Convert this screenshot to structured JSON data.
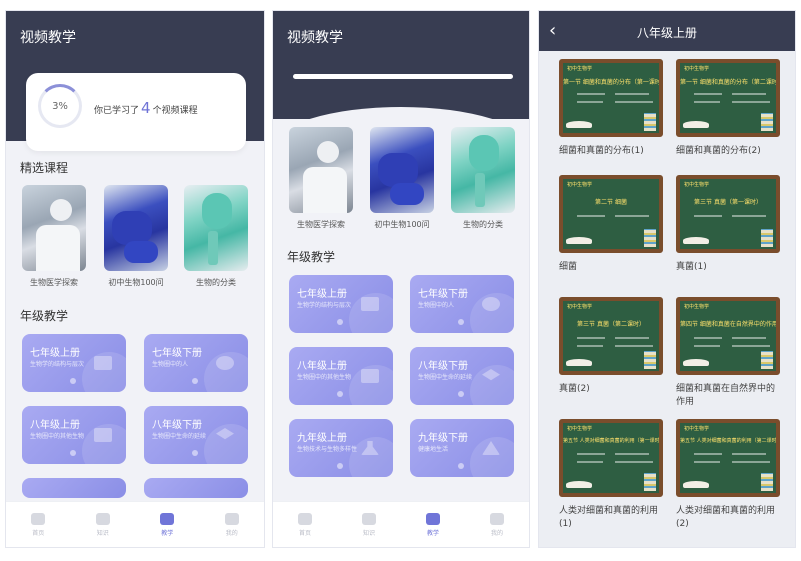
{
  "screen1": {
    "header_title": "视频教学",
    "progress": {
      "percent_label": "3%",
      "percent_value": 3,
      "text_before": "你已学习了",
      "count": "4",
      "text_after": "个视频课程"
    },
    "featured_title": "精选课程",
    "courses": [
      {
        "caption": "生物医学探索"
      },
      {
        "caption": "初中生物100问"
      },
      {
        "caption": "生物的分类"
      }
    ],
    "grade_title": "年级教学",
    "grades": [
      {
        "name": "七年级上册",
        "sub": "生物学的结构与层次"
      },
      {
        "name": "七年级下册",
        "sub": "生物圈中的人"
      },
      {
        "name": "八年级上册",
        "sub": "生物圈中的其他生物"
      },
      {
        "name": "八年级下册",
        "sub": "生物圈中生命的延续"
      }
    ],
    "tabs": [
      {
        "label": "首页"
      },
      {
        "label": "知识"
      },
      {
        "label": "教学"
      },
      {
        "label": "我的"
      }
    ]
  },
  "screen2": {
    "header_title": "视频教学",
    "courses": [
      {
        "caption": "生物医学探索"
      },
      {
        "caption": "初中生物100问"
      },
      {
        "caption": "生物的分类"
      }
    ],
    "grade_title": "年级教学",
    "grades": [
      {
        "name": "七年级上册",
        "sub": "生物学的结构与层次"
      },
      {
        "name": "七年级下册",
        "sub": "生物圈中的人"
      },
      {
        "name": "八年级上册",
        "sub": "生物圈中的其他生物"
      },
      {
        "name": "八年级下册",
        "sub": "生物圈中生命的延续"
      },
      {
        "name": "九年级上册",
        "sub": "生物技术与生物多样性"
      },
      {
        "name": "九年级下册",
        "sub": "健康地生活"
      }
    ],
    "tabs": [
      {
        "label": "首页"
      },
      {
        "label": "知识"
      },
      {
        "label": "教学"
      },
      {
        "label": "我的"
      }
    ]
  },
  "screen3": {
    "nav_title": "八年级上册",
    "back_glyph": "‹",
    "board_header": "初中生物学",
    "items": [
      {
        "board_title": "第一节 细菌和真菌的分布（第一课时）",
        "caption": "细菌和真菌的分布(1)"
      },
      {
        "board_title": "第一节 细菌和真菌的分布（第二课时）",
        "caption": "细菌和真菌的分布(2)"
      },
      {
        "board_title": "第二节 细菌",
        "caption": "细菌"
      },
      {
        "board_title": "第三节 真菌（第一课时）",
        "caption": "真菌(1)"
      },
      {
        "board_title": "第三节 真菌（第二课时）",
        "caption": "真菌(2)"
      },
      {
        "board_title": "第四节 细菌和真菌在自然界中的作用",
        "caption": "细菌和真菌在自然界中的作用"
      },
      {
        "board_title": "第五节 人类对细菌和真菌的利用（第一课时）",
        "caption": "人类对细菌和真菌的利用(1)"
      },
      {
        "board_title": "第五节 人类对细菌和真菌的利用（第二课时）",
        "caption": "人类对细菌和真菌的利用(2)"
      }
    ]
  }
}
